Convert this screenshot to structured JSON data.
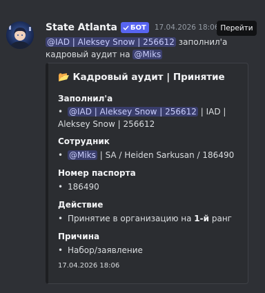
{
  "message": {
    "username": "State Atlanta",
    "bot_badge": "БОТ",
    "timestamp": "17.04.2026 18:06",
    "goto_button": "Перейти",
    "content": {
      "mention1": "@IAD | Aleksey Snow | 256612",
      "text1": " заполнил'а",
      "text2": "кадровый аудит на ",
      "mention2": "@Miks"
    }
  },
  "embed": {
    "title_icon": "📂",
    "title": "Кадровый аудит | Принятие",
    "fields": [
      {
        "name": "Заполнил'а",
        "mention": "@IAD | Aleksey Snow | 256612",
        "value": " | IAD |",
        "value2": "Aleksey Snow | 256612"
      },
      {
        "name": "Сотрудник",
        "mention": "@Miks",
        "value": " | SA / Heiden Sarkusan / 186490"
      },
      {
        "name": "Номер паспорта",
        "value": "186490"
      },
      {
        "name": "Действие",
        "value_pre": "Принятие в организацию на ",
        "value_bold": "1-й",
        "value_post": " ранг"
      },
      {
        "name": "Причина",
        "value": "Набор/заявление"
      }
    ],
    "footer": "17.04.2026 18:06"
  },
  "bullet": "•",
  "colors": {
    "background": "#2e3035",
    "embed_bg": "#2b2d31",
    "mention_text": "#c9cdfb",
    "bot_badge": "#5865f2"
  }
}
